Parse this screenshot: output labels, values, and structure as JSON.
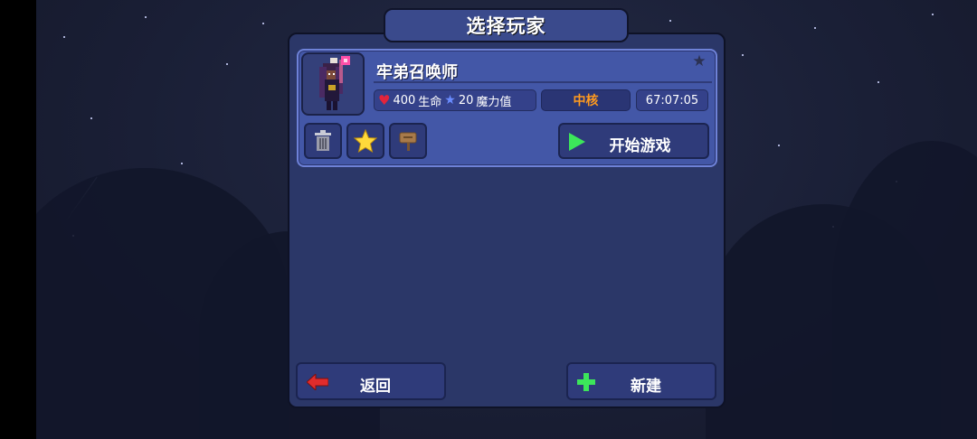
{
  "screen": {
    "title": "选择玩家"
  },
  "character": {
    "name": "牢弟召唤师",
    "life_value": "400",
    "life_label": "生命",
    "mana_value": "20",
    "mana_label": "魔力值",
    "difficulty": "中核",
    "playtime": "67:07:05",
    "favorited": true
  },
  "card_actions": {
    "delete_icon": "trash-icon",
    "favorite_icon": "star-icon",
    "rename_icon": "sign-icon",
    "play_label": "开始游戏"
  },
  "footer": {
    "back_label": "返回",
    "new_label": "新建"
  },
  "colors": {
    "panel": "#2b3768",
    "card": "#4357a7",
    "difficulty_text": "#ff9a1e",
    "play_icon": "#3ce65a",
    "back_icon": "#e02c2c",
    "heart": "#e3243b"
  }
}
